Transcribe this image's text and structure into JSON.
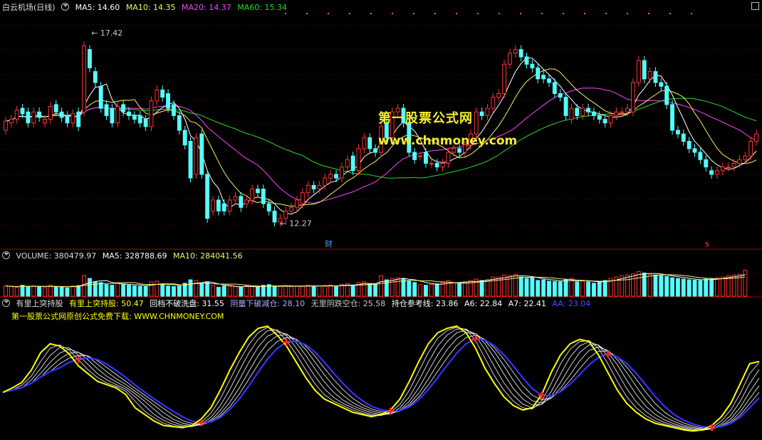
{
  "main": {
    "title": "白云机场(日线)",
    "ma5": "MA5: 14.60",
    "ma10": "MA10: 14.35",
    "ma20": "MA20: 14.37",
    "ma60": "MA60: 15.34",
    "high_label": "17.42",
    "low_label": "12.27",
    "cai_label": "财",
    "s_label": "s"
  },
  "volume": {
    "title": "VOLUME: 380479.97",
    "ma5": "MA5: 328788.69",
    "ma10": "MA10: 284041.56"
  },
  "indicator": {
    "name": "有里上突持股",
    "l1": "有里上突持股: 50.47",
    "l2": "回档不破洗盘: 31.55",
    "l3": "阴量下破减仓: 28.10",
    "l4": "无里阴跌空仓: 25.58",
    "l5": "持仓参考线: 23.86",
    "l6": "A6: 22.84",
    "l7": "A7: 22.41",
    "l8": "AA: 23.04",
    "promo": "第一股票公式网原创公式免费下载: WWW.CHNMONEY.COM"
  },
  "watermark": {
    "line1": "第一股票公式网",
    "line2": "www.chnmoney.com"
  },
  "colors": {
    "up": "#ff3333",
    "down": "#54ffff",
    "ma5": "#ffffff",
    "ma10": "#f2f26a",
    "ma20": "#ff44ff",
    "ma60": "#22dd22",
    "yellow": "#ffff00",
    "blue": "#3333ff",
    "grid": "#8a0000",
    "sep": "#b00000"
  },
  "chart_data": {
    "type": "candlestick",
    "price_range": [
      11.6,
      18.0
    ],
    "price_ticks_marked": {
      "high": 17.42,
      "low": 12.27
    },
    "close": [
      15.05,
      15.1,
      15.35,
      15.25,
      15.0,
      15.3,
      15.15,
      15.1,
      15.45,
      15.3,
      15.15,
      15.0,
      15.25,
      14.9,
      17.1,
      16.5,
      16.1,
      15.4,
      15.2,
      15.0,
      15.45,
      15.3,
      15.2,
      15.1,
      15.0,
      14.9,
      15.6,
      15.9,
      15.7,
      15.4,
      15.2,
      14.8,
      14.4,
      13.5,
      14.6,
      13.6,
      12.4,
      12.9,
      12.6,
      12.6,
      12.9,
      13.0,
      12.7,
      12.9,
      13.2,
      13.1,
      12.8,
      12.6,
      12.3,
      12.4,
      12.6,
      12.7,
      12.9,
      13.1,
      13.3,
      13.2,
      13.3,
      13.5,
      13.6,
      13.5,
      13.8,
      14.0,
      13.7,
      14.3,
      14.6,
      14.3,
      14.2,
      14.9,
      14.6,
      15.3,
      15.4,
      15.0,
      14.2,
      14.0,
      14.1,
      13.9,
      13.9,
      13.8,
      13.9,
      14.2,
      14.3,
      14.2,
      14.4,
      14.7,
      15.3,
      15.2,
      15.4,
      15.7,
      15.8,
      16.6,
      16.9,
      17.0,
      16.8,
      16.6,
      16.5,
      16.2,
      16.2,
      16.1,
      15.8,
      15.7,
      15.2,
      15.4,
      15.2,
      15.4,
      15.3,
      15.2,
      15.1,
      15.0,
      15.2,
      15.3,
      15.3,
      15.4,
      16.1,
      16.7,
      16.2,
      16.4,
      16.1,
      16.0,
      15.5,
      14.8,
      14.7,
      14.5,
      14.3,
      14.2,
      14.0,
      13.8,
      13.6,
      13.7,
      13.8,
      13.8,
      13.9,
      14.0,
      14.1,
      14.5,
      14.7
    ],
    "open": [
      14.8,
      15.0,
      15.1,
      15.4,
      15.3,
      15.0,
      15.3,
      15.0,
      15.1,
      15.5,
      15.3,
      15.2,
      15.0,
      15.3,
      15.3,
      17.0,
      16.4,
      16.0,
      15.5,
      15.4,
      15.0,
      15.5,
      15.3,
      15.2,
      15.2,
      15.1,
      14.9,
      15.6,
      15.9,
      15.8,
      15.5,
      15.2,
      14.8,
      14.5,
      13.6,
      14.7,
      13.6,
      12.6,
      12.9,
      12.8,
      12.6,
      12.9,
      13.0,
      12.8,
      12.9,
      13.2,
      13.2,
      12.8,
      12.6,
      12.3,
      12.4,
      12.6,
      12.7,
      12.8,
      13.1,
      13.3,
      13.2,
      13.3,
      13.5,
      13.6,
      13.5,
      13.8,
      14.1,
      13.7,
      14.3,
      14.6,
      14.3,
      14.2,
      15.0,
      14.6,
      15.3,
      15.4,
      15.0,
      14.2,
      14.1,
      14.2,
      13.9,
      13.9,
      13.8,
      13.9,
      14.2,
      14.3,
      14.2,
      14.4,
      14.7,
      15.3,
      15.2,
      15.4,
      15.7,
      15.8,
      16.6,
      16.9,
      17.0,
      16.8,
      16.6,
      16.5,
      16.3,
      16.2,
      16.1,
      15.8,
      15.7,
      15.1,
      15.4,
      15.2,
      15.4,
      15.3,
      15.2,
      15.1,
      15.0,
      15.2,
      15.3,
      15.3,
      15.3,
      16.1,
      16.7,
      16.2,
      16.4,
      16.1,
      16.0,
      15.5,
      14.8,
      14.7,
      14.5,
      14.3,
      14.2,
      14.0,
      13.7,
      13.6,
      13.7,
      13.8,
      13.8,
      13.9,
      14.0,
      14.1,
      14.5
    ],
    "volume_range": [
      0,
      500000
    ],
    "volume": [
      150000,
      140000,
      130000,
      160000,
      145000,
      150000,
      135000,
      125000,
      160000,
      140000,
      135000,
      120000,
      150000,
      155000,
      300000,
      260000,
      210000,
      200000,
      170000,
      160000,
      200000,
      170000,
      160000,
      150000,
      145000,
      140000,
      210000,
      220000,
      180000,
      150000,
      140000,
      150000,
      190000,
      240000,
      230000,
      180000,
      210000,
      150000,
      130000,
      150000,
      145000,
      140000,
      130000,
      150000,
      140000,
      130000,
      160000,
      170000,
      150000,
      140000,
      150000,
      140000,
      145000,
      150000,
      160000,
      145000,
      150000,
      155000,
      160000,
      140000,
      175000,
      185000,
      150000,
      200000,
      210000,
      180000,
      170000,
      300000,
      240000,
      260000,
      270000,
      250000,
      220000,
      200000,
      170000,
      160000,
      170000,
      180000,
      200000,
      230000,
      200000,
      190000,
      210000,
      230000,
      250000,
      230000,
      240000,
      280000,
      280000,
      310000,
      300000,
      320000,
      280000,
      260000,
      270000,
      230000,
      240000,
      220000,
      215000,
      210000,
      240000,
      260000,
      210000,
      220000,
      210000,
      190000,
      215000,
      230000,
      260000,
      280000,
      300000,
      310000,
      330000,
      360000,
      340000,
      320000,
      310000,
      300000,
      290000,
      270000,
      260000,
      250000,
      240000,
      235000,
      230000,
      250000,
      260000,
      270000,
      280000,
      300000,
      310000,
      320000,
      380479
    ],
    "oscillator_range": [
      0,
      100
    ],
    "yellow_line": [
      38,
      42,
      47,
      58,
      74,
      82,
      80,
      73,
      62,
      55,
      48,
      45,
      42,
      36,
      24,
      18,
      12,
      8,
      7,
      6,
      8,
      14,
      24,
      40,
      58,
      74,
      88,
      96,
      98,
      90,
      80,
      66,
      52,
      40,
      32,
      28,
      24,
      20,
      18,
      16,
      18,
      22,
      32,
      48,
      66,
      82,
      92,
      96,
      98,
      92,
      78,
      60,
      46,
      34,
      26,
      22,
      24,
      36,
      56,
      72,
      82,
      86,
      84,
      72,
      56,
      40,
      28,
      20,
      14,
      10,
      8,
      6,
      4,
      3,
      4,
      8,
      16,
      28,
      46,
      64,
      66
    ]
  }
}
